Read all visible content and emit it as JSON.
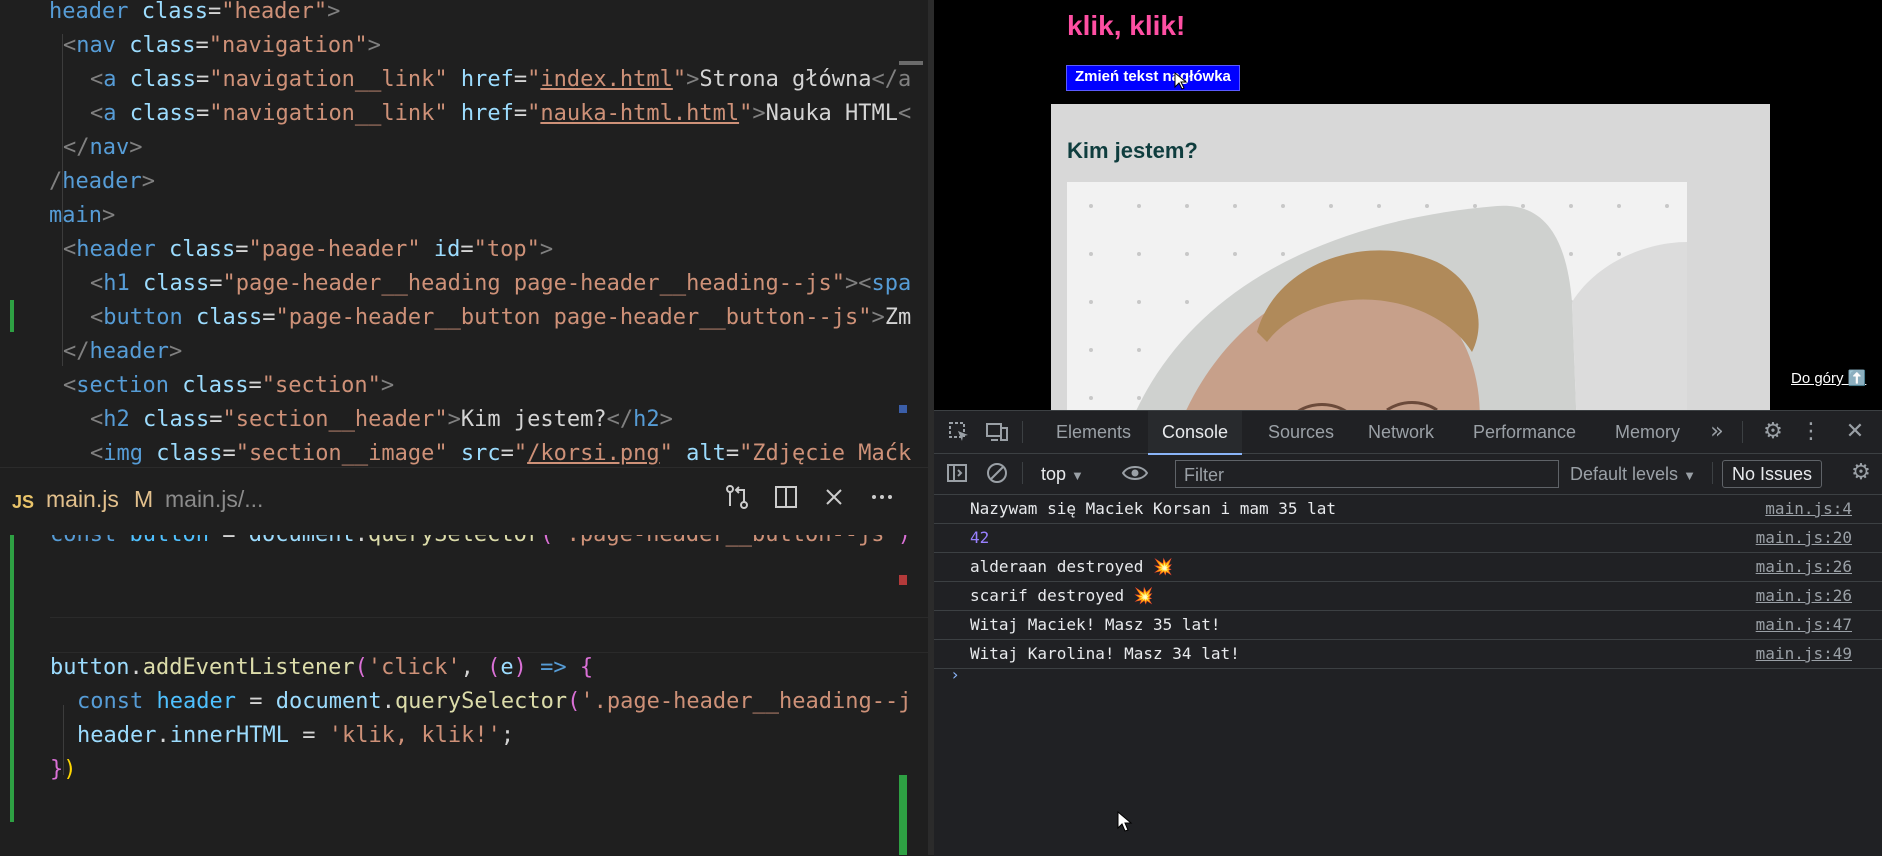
{
  "editor": {
    "html_lines": [
      {
        "prefix": "header ",
        "attr": "class",
        "value": "\"header\"",
        "close": ">"
      },
      {
        "indent": "<nav ",
        "attr": "class",
        "value": "\"navigation\"",
        "close": ">"
      },
      {
        "indent": "<a ",
        "attr": "class",
        "value": "\"navigation__link\""
      },
      {
        "indent": "<a ",
        "attr": "class",
        "value": "\"navigation__link\""
      },
      {
        "text": "</nav>"
      },
      {
        "text": "/header>"
      },
      {
        "text": "main>"
      },
      {
        "text": "<header class=\"page-header\" id=\"top\">"
      },
      {
        "text": "<h1 class=\"page-header__heading page-header__heading--js\"><spa"
      },
      {
        "text": "<button class=\"page-header__button page-header__button--js\">Zm"
      },
      {
        "text": "</header>"
      },
      {
        "text": "<section class=\"section\">"
      },
      {
        "text": "<h2 class=\"section__header\">Kim jestem?</h2>"
      },
      {
        "text": "<img class=\"section__image\" src=\"/korsi.png\" alt=\"Zdjęcie Maćk"
      }
    ],
    "link1_href": "index.html",
    "link1_text": "Strona główna",
    "link2_href": "nauka-html.html",
    "link2_text": "Nauka HTML",
    "tab": {
      "language_icon": "JS",
      "file_name": "main.js",
      "modified_flag": "M",
      "path": "main.js/..."
    },
    "js_code": {
      "line1": "const button = document.querySelector('.page-header__button--js')",
      "listener_obj": "button",
      "listener_method": "addEventListener",
      "event": "'click'",
      "param": "e",
      "line_header_selector": "'.page-header__heading--j",
      "inner_html_value": "'klik, klik!'"
    }
  },
  "preview": {
    "heading": "klik, klik!",
    "button_label": "Zmień tekst nagłówka",
    "section_header": "Kim jestem?",
    "to_top_link": "Do góry ⬆️"
  },
  "devtools": {
    "tabs": [
      "Elements",
      "Console",
      "Sources",
      "Network",
      "Performance",
      "Memory"
    ],
    "active_tab": "Console",
    "context": "top",
    "filter_placeholder": "Filter",
    "levels": "Default levels",
    "issues": "No Issues",
    "logs": [
      {
        "msg": "Nazywam się Maciek Korsan i mam 35 lat",
        "src": "main.js:4",
        "type": "text"
      },
      {
        "msg": "42",
        "src": "main.js:20",
        "type": "number"
      },
      {
        "msg": "alderaan destroyed 💥",
        "src": "main.js:26",
        "type": "text"
      },
      {
        "msg": "scarif destroyed 💥",
        "src": "main.js:26",
        "type": "text"
      },
      {
        "msg": "Witaj Maciek! Masz 35 lat!",
        "src": "main.js:47",
        "type": "text"
      },
      {
        "msg": "Witaj Karolina! Masz 34 lat!",
        "src": "main.js:49",
        "type": "text"
      }
    ]
  },
  "colors": {
    "accent_pink": "#ff4fa3",
    "button_blue": "#0000ff",
    "devtools_blue": "#8ab4f8"
  }
}
